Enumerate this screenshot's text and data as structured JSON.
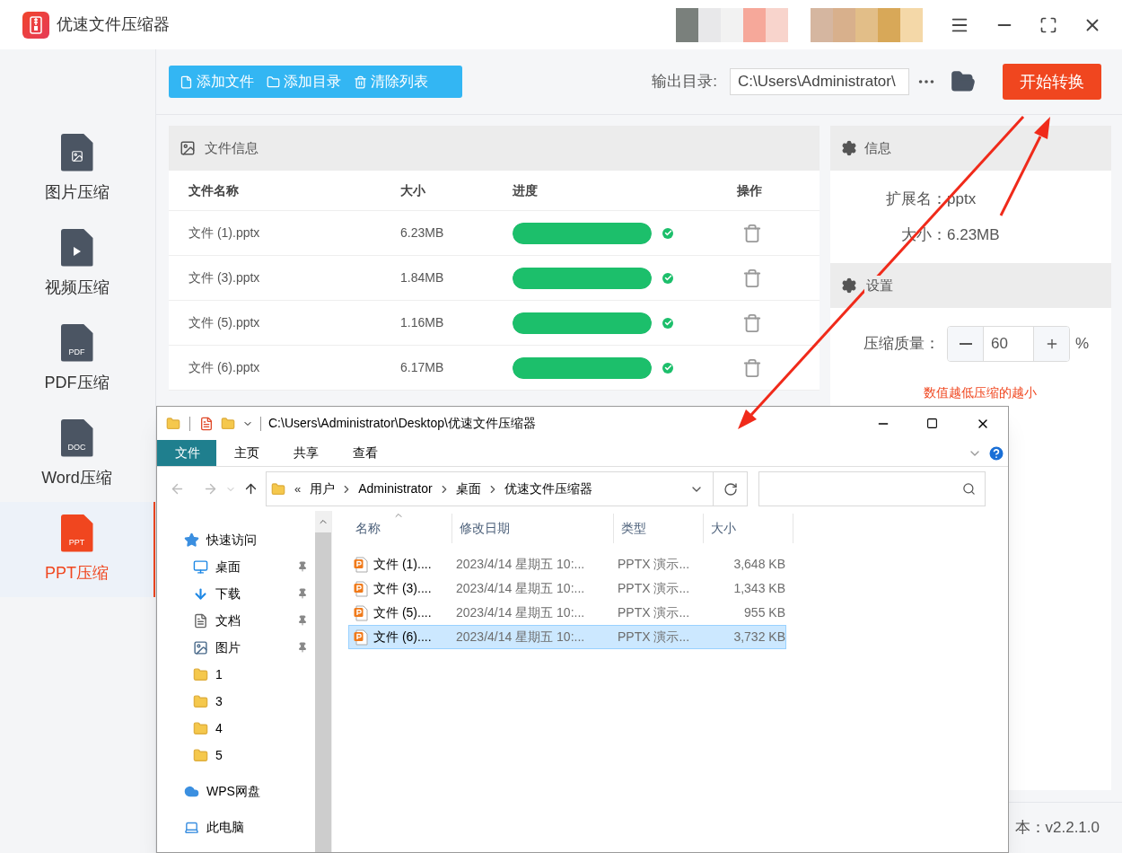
{
  "app": {
    "title": "优速文件压缩器"
  },
  "sidebar": [
    {
      "kind": "image",
      "label": "图片压缩",
      "selected": false
    },
    {
      "kind": "video",
      "label": "视频压缩",
      "selected": false
    },
    {
      "kind": "doc",
      "badge": "PDF",
      "label": "PDF压缩",
      "selected": false
    },
    {
      "kind": "doc",
      "badge": "DOC",
      "label": "Word压缩",
      "selected": false
    },
    {
      "kind": "doc",
      "badge": "PPT",
      "label": "PPT压缩",
      "selected": true
    }
  ],
  "toolbar": {
    "buttons": [
      {
        "kind": "file",
        "label": "添加文件"
      },
      {
        "kind": "folder",
        "label": "添加目录"
      },
      {
        "kind": "trash",
        "label": "清除列表"
      }
    ],
    "output_label": "输出目录:",
    "output_path": "C:\\Users\\Administrator\\",
    "start_button": "开始转换"
  },
  "file_panel": {
    "title": "文件信息",
    "columns": [
      "文件名称",
      "大小",
      "进度",
      "操作"
    ],
    "rows": [
      {
        "name": "文件 (1).pptx",
        "size": "6.23MB",
        "level": 1,
        "done": true
      },
      {
        "name": "文件 (3).pptx",
        "size": "1.84MB",
        "level": 1,
        "done": true
      },
      {
        "name": "文件 (5).pptx",
        "size": "1.16MB",
        "level": 1,
        "done": true
      },
      {
        "name": "文件 (6).pptx",
        "size": "6.17MB",
        "level": 1,
        "done": true
      }
    ]
  },
  "info": {
    "title": "信息",
    "fields": [
      {
        "label": "扩展名：",
        "value": "pptx"
      },
      {
        "label": "大小：",
        "value": "6.23MB"
      }
    ]
  },
  "settings": {
    "title": "设置",
    "quality_label": "压缩质量：",
    "quality_value": "60",
    "unit": "%",
    "hint": "数值越低压缩的越小"
  },
  "version": "本：v2.2.1.0",
  "explorer": {
    "path": "C:\\Users\\Administrator\\Desktop\\优速文件压缩器",
    "ribbon_tabs": [
      {
        "label": "文件",
        "selected": true
      },
      {
        "label": "主页",
        "selected": false
      },
      {
        "label": "共享",
        "selected": false
      },
      {
        "label": "查看",
        "selected": false
      }
    ],
    "overflow": "«",
    "breadcrumb": [
      "用户",
      "Administrator",
      "桌面",
      "优速文件压缩器"
    ],
    "nav": [
      {
        "kind": "star",
        "label": "快速访问",
        "children": [
          {
            "kind": "desktop",
            "label": "桌面",
            "pinned": true
          },
          {
            "kind": "download",
            "label": "下载",
            "pinned": true
          },
          {
            "kind": "docs",
            "label": "文档",
            "pinned": true
          },
          {
            "kind": "pictures",
            "label": "图片",
            "pinned": true
          },
          {
            "kind": "folder",
            "label": "1",
            "pinned": false
          },
          {
            "kind": "folder",
            "label": "3",
            "pinned": false
          },
          {
            "kind": "folder",
            "label": "4",
            "pinned": false
          },
          {
            "kind": "folder",
            "label": "5",
            "pinned": false
          }
        ]
      },
      {
        "kind": "cloud",
        "label": "WPS网盘"
      },
      {
        "kind": "pc",
        "label": "此电脑"
      }
    ],
    "columns": [
      "名称",
      "修改日期",
      "类型",
      "大小"
    ],
    "files": [
      {
        "name": "文件 (1)....",
        "date": "2023/4/14 星期五 10:...",
        "type": "PPTX 演示...",
        "size": "3,648 KB",
        "selected": false
      },
      {
        "name": "文件 (3)....",
        "date": "2023/4/14 星期五 10:...",
        "type": "PPTX 演示...",
        "size": "1,343 KB",
        "selected": false
      },
      {
        "name": "文件 (5)....",
        "date": "2023/4/14 星期五 10:...",
        "type": "PPTX 演示...",
        "size": "955 KB",
        "selected": false
      },
      {
        "name": "文件 (6)....",
        "date": "2023/4/14 星期五 10:...",
        "type": "PPTX 演示...",
        "size": "3,732 KB",
        "selected": true
      }
    ]
  }
}
